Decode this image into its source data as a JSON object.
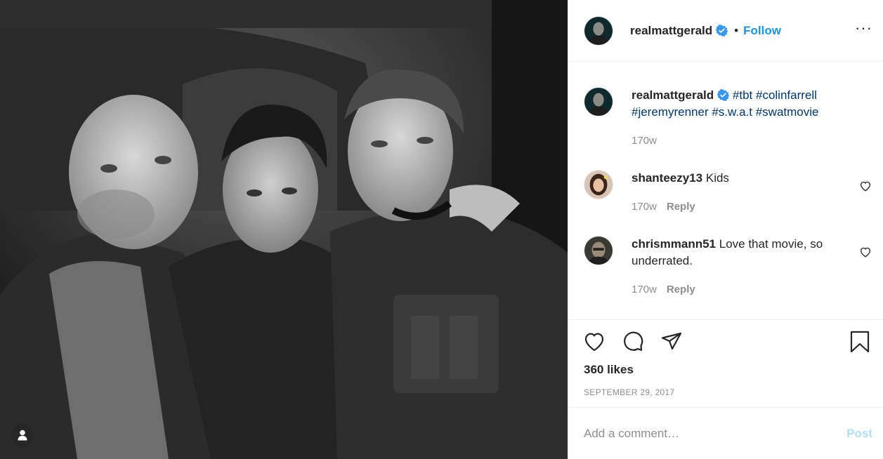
{
  "post": {
    "username": "realmattgerald",
    "separator": "•",
    "follow_label": "Follow",
    "more_label": "···"
  },
  "caption": {
    "username": "realmattgerald",
    "hashtags": [
      "#tbt",
      "#colinfarrell",
      "#jeremyrenner",
      "#s.w.a.t",
      "#swatmovie"
    ],
    "time": "170w"
  },
  "comments": [
    {
      "username": "shanteezy13",
      "text": "Kids",
      "time": "170w",
      "reply_label": "Reply"
    },
    {
      "username": "chrismmann51",
      "text": "Love that movie, so underrated.",
      "time": "170w",
      "reply_label": "Reply"
    }
  ],
  "stats": {
    "likes": "360 likes",
    "date": "SEPTEMBER 29, 2017"
  },
  "composer": {
    "placeholder": "Add a comment…",
    "post_label": "Post"
  },
  "icons": {
    "verified": "verified-badge-icon",
    "like": "heart-icon",
    "comment": "comment-bubble-icon",
    "share": "paper-plane-icon",
    "save": "bookmark-icon",
    "user_tags": "user-silhouette-icon"
  },
  "colors": {
    "link_blue": "#1b95e0",
    "hashtag": "#00376b",
    "muted": "#8e8e8e",
    "post_disabled": "#b2dffc"
  }
}
